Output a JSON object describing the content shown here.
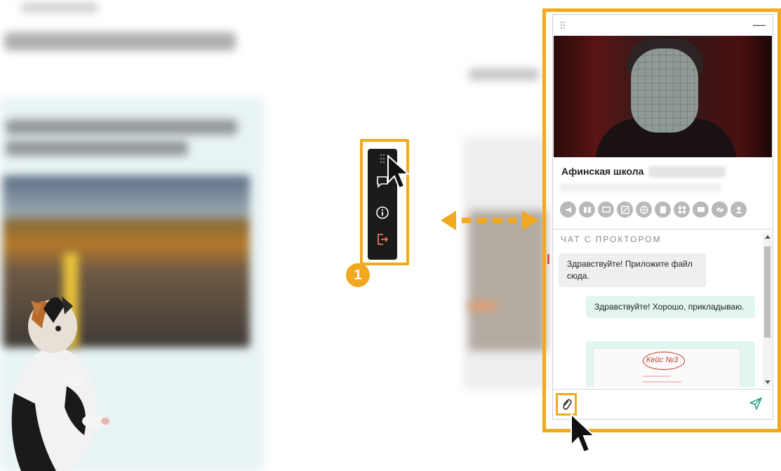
{
  "toolbar": {
    "badge_number": "1",
    "buttons": [
      "drag-handle",
      "chat",
      "info",
      "exit"
    ]
  },
  "panel": {
    "school_name": "Афинская школа",
    "chat_title": "ЧАТ С ПРОКТОРОМ",
    "messages": [
      {
        "direction": "in",
        "text": "Здравствуйте! Приложите файл сюда."
      },
      {
        "direction": "out",
        "text": "Здравствуйте! Хорошо, прикладываю."
      },
      {
        "direction": "out",
        "type": "attachment",
        "text": "Кейс №3"
      }
    ],
    "status_icons": [
      "megaphone-icon",
      "book-icon",
      "presentation-icon",
      "edit-icon",
      "globe-icon",
      "document-icon",
      "grid-icon",
      "screen-icon",
      "eye-off-icon",
      "user-icon"
    ]
  },
  "colors": {
    "highlight": "#f2a91f",
    "toolbar_bg": "#1b1b1b",
    "exit_icon": "#e8765a",
    "outgoing_bubble": "#e1f5f1",
    "incoming_bubble": "#efefef",
    "send_icon": "#2aa58a"
  }
}
